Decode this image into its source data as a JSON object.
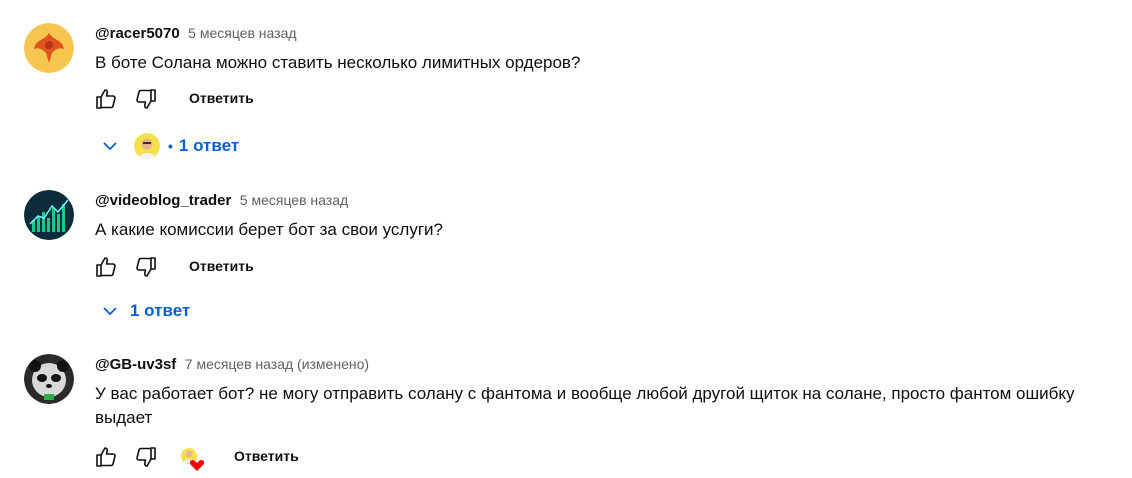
{
  "comments": [
    {
      "author": "@racer5070",
      "time": "5 месяцев назад",
      "text": "В боте Солана можно ставить несколько лимитных ордеров?",
      "reply_label": "Ответить",
      "replies_label": "1 ответ",
      "avatar_icon": "phoenix-avatar"
    },
    {
      "author": "@videoblog_trader",
      "time": "5 месяцев назад",
      "text": "А какие комиссии берет бот за свои услуги?",
      "reply_label": "Ответить",
      "replies_label": "1 ответ",
      "avatar_icon": "chart-avatar"
    },
    {
      "author": "@GB-uv3sf",
      "time": "7 месяцев назад (изменено)",
      "text": "У вас работает бот? не могу отправить солану с фантома и вообще любой другой щиток на солане, просто фантом ошибку выдает",
      "reply_label": "Ответить",
      "avatar_icon": "panda-avatar",
      "creator_heart": true
    }
  ],
  "colors": {
    "link": "#065fd4",
    "meta": "#606060",
    "text": "#0f0f0f",
    "heart": "#ff0000"
  }
}
